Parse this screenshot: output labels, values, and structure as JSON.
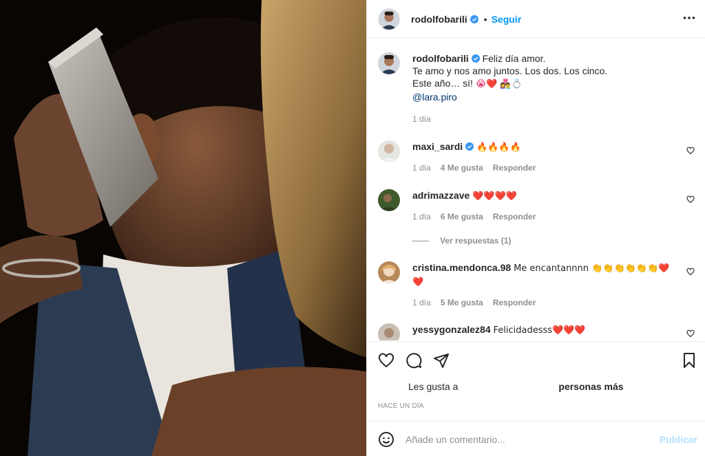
{
  "post": {
    "author": "rodolfobarili",
    "follow_label": "Seguir",
    "separator": "•",
    "caption_lines": [
      "Feliz día amor.",
      "Te amo y nos amo juntos. Los dos. Los cinco.",
      "Este año… sí!"
    ],
    "caption_emojis": "😭❤️ 👩‍❤️‍👨💍",
    "mention": "@lara.piro",
    "caption_time": "1 día"
  },
  "comments": [
    {
      "user": "maxi_sardi",
      "verified": true,
      "text": "🔥🔥🔥🔥",
      "time": "1 día",
      "likes": "4 Me gusta",
      "reply": "Responder"
    },
    {
      "user": "adrimazzave",
      "verified": false,
      "text": "❤️❤️❤️❤️",
      "time": "1 día",
      "likes": "6 Me gusta",
      "reply": "Responder"
    },
    {
      "user": "cristina.mendonca.98",
      "verified": false,
      "text": "Me encantannnn 👏👏👏👏👏👏❤️",
      "text2": "❤️",
      "time": "1 día",
      "likes": "5 Me gusta",
      "reply": "Responder"
    },
    {
      "user": "yessygonzalez84",
      "verified": false,
      "text": "Felicidadesss❤️❤️❤️"
    }
  ],
  "view_replies": "Ver respuestas (1)",
  "likes_prefix": "Les gusta a",
  "likes_suffix": "personas más",
  "post_date": "HACE UN DÍA",
  "comment_box": {
    "placeholder": "Añade un comentario...",
    "publish_label": "Publicar"
  },
  "colors": {
    "accent": "#0095f6",
    "verified": "#3897f0",
    "publish_disabled": "#b2dffc",
    "mention": "#00376b"
  },
  "icons": [
    "more-icon",
    "heart-icon",
    "comment-icon",
    "share-icon",
    "bookmark-icon",
    "smile-icon",
    "verified-icon"
  ]
}
